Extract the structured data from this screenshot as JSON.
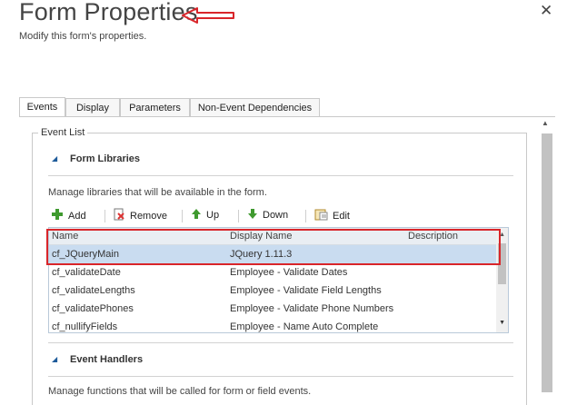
{
  "dialog": {
    "title": "Form Properties",
    "subtitle": "Modify this form's properties.",
    "close_label": "✕"
  },
  "tabs": [
    {
      "label": "Events",
      "active": true
    },
    {
      "label": "Display",
      "active": false
    },
    {
      "label": "Parameters",
      "active": false
    },
    {
      "label": "Non-Event Dependencies",
      "active": false
    }
  ],
  "event_list": {
    "legend": "Event List",
    "form_libraries": {
      "title": "Form Libraries",
      "description": "Manage libraries that will be available in the form.",
      "toolbar": {
        "add_label": "Add",
        "remove_label": "Remove",
        "up_label": "Up",
        "down_label": "Down",
        "edit_label": "Edit"
      },
      "columns": [
        "Name",
        "Display Name",
        "Description"
      ],
      "rows": [
        {
          "name": "cf_JQueryMain",
          "display_name": "JQuery 1.11.3",
          "description": "",
          "selected": true
        },
        {
          "name": "cf_validateDate",
          "display_name": "Employee - Validate Dates",
          "description": "",
          "selected": false
        },
        {
          "name": "cf_validateLengths",
          "display_name": "Employee - Validate Field Lengths",
          "description": "",
          "selected": false
        },
        {
          "name": "cf_validatePhones",
          "display_name": "Employee - Validate Phone Numbers",
          "description": "",
          "selected": false
        },
        {
          "name": "cf_nullifyFields",
          "display_name": "Employee - Name Auto Complete",
          "description": "",
          "selected": false
        }
      ]
    },
    "event_handlers": {
      "title": "Event Handlers",
      "description": "Manage functions that will be called for form or field events."
    }
  },
  "colors": {
    "highlight_red": "#d9252a",
    "selected_row": "#c9dcf0",
    "section_triangle": "#1e5b9a"
  }
}
